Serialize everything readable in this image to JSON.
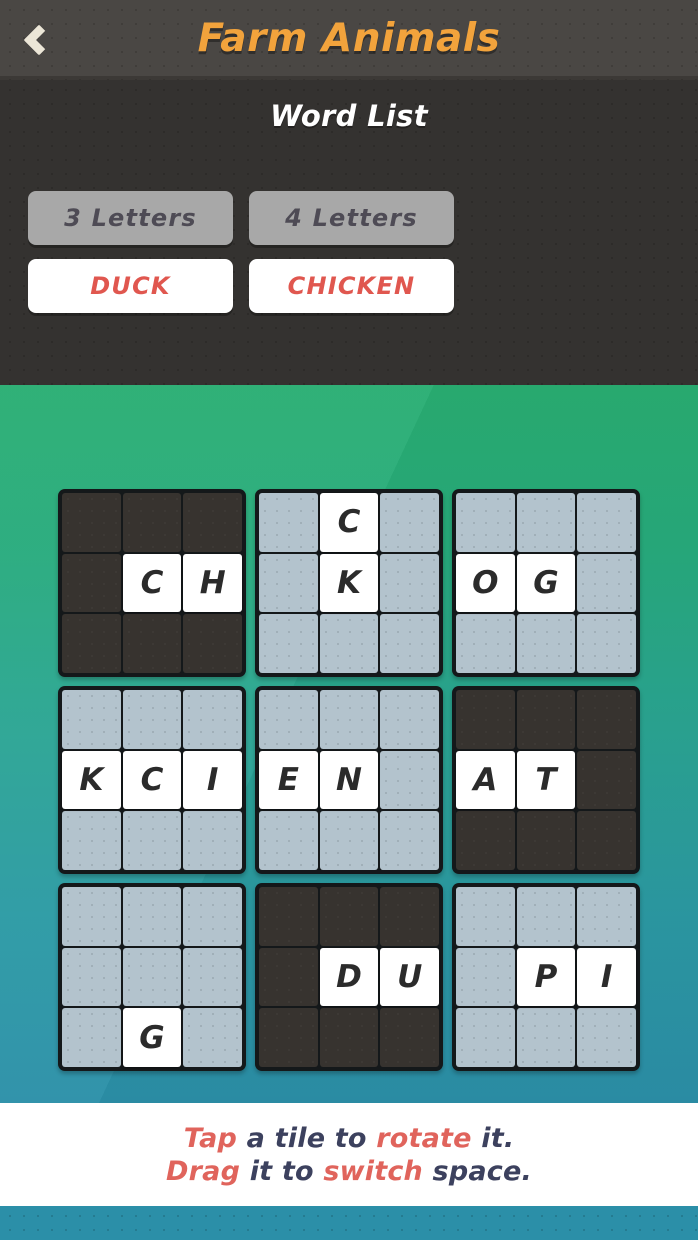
{
  "header": {
    "title": "Farm Animals",
    "back_icon": "chevron-left-icon",
    "title_color": "#f2a33c"
  },
  "word_list": {
    "title": "Word List",
    "chips": [
      {
        "label": "3 Letters",
        "type": "group",
        "solved": false
      },
      {
        "label": "4 Letters",
        "type": "group",
        "solved": false
      },
      {
        "label": "DUCK",
        "type": "word",
        "solved": true
      },
      {
        "label": "CHICKEN",
        "type": "word",
        "solved": true
      }
    ],
    "group_chip_color": "#a8a8a8",
    "word_chip_text_color": "#e0574f"
  },
  "board": {
    "rows": 3,
    "cols": 3,
    "tiles": [
      {
        "id": "tile-1",
        "theme": "dark",
        "cells": [
          "",
          "",
          "",
          "",
          "C",
          "H",
          "",
          "",
          ""
        ]
      },
      {
        "id": "tile-2",
        "theme": "light",
        "cells": [
          "",
          "C",
          "",
          "",
          "K",
          "",
          "",
          "",
          ""
        ]
      },
      {
        "id": "tile-3",
        "theme": "light",
        "cells": [
          "",
          "",
          "",
          "O",
          "G",
          "",
          "",
          "",
          ""
        ]
      },
      {
        "id": "tile-4",
        "theme": "light",
        "cells": [
          "",
          "",
          "",
          "K",
          "C",
          "I",
          "",
          "",
          ""
        ]
      },
      {
        "id": "tile-5",
        "theme": "light",
        "cells": [
          "",
          "",
          "",
          "E",
          "N",
          "",
          "",
          "",
          ""
        ]
      },
      {
        "id": "tile-6",
        "theme": "dark",
        "cells": [
          "",
          "",
          "",
          "A",
          "T",
          "",
          "",
          "",
          ""
        ]
      },
      {
        "id": "tile-7",
        "theme": "light",
        "cells": [
          "",
          "",
          "",
          "",
          "",
          "",
          "",
          "G",
          ""
        ]
      },
      {
        "id": "tile-8",
        "theme": "dark",
        "cells": [
          "",
          "",
          "",
          "",
          "D",
          "U",
          "",
          "",
          ""
        ]
      },
      {
        "id": "tile-9",
        "theme": "light",
        "cells": [
          "",
          "",
          "",
          "",
          "P",
          "I",
          "",
          "",
          ""
        ]
      }
    ],
    "background_top_color": "#29ae72",
    "background_bottom_color": "#2b8fa8"
  },
  "footer": {
    "line1": [
      {
        "text": "Tap ",
        "highlight": true
      },
      {
        "text": "a tile to ",
        "highlight": false
      },
      {
        "text": "rotate ",
        "highlight": true
      },
      {
        "text": "it.",
        "highlight": false
      }
    ],
    "line2": [
      {
        "text": "Drag ",
        "highlight": true
      },
      {
        "text": "it to ",
        "highlight": false
      },
      {
        "text": "switch ",
        "highlight": true
      },
      {
        "text": "space.",
        "highlight": false
      }
    ],
    "highlight_color": "#e0645c",
    "text_color": "#3c415e"
  }
}
